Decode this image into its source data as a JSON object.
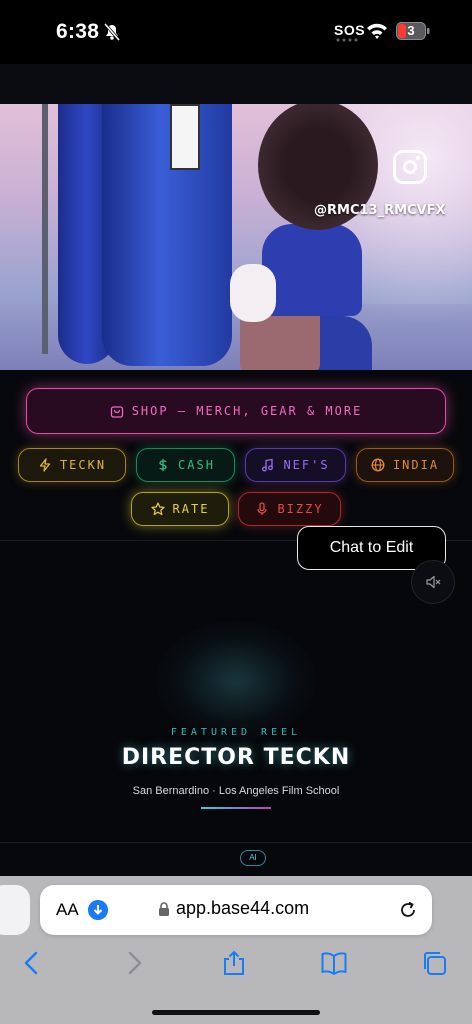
{
  "status_bar": {
    "time": "6:38",
    "sos": "SOS",
    "battery": "3"
  },
  "hero": {
    "instagram_handle": "@RMC13_RMCVFX"
  },
  "links": {
    "shop": "SHOP – MERCH, GEAR & MORE",
    "teckn": "TECKN",
    "cash": "CASH",
    "nefs": "NEF'S",
    "india": "INDIA",
    "rate": "RATE",
    "bizzy": "BIZZY"
  },
  "chat_button": "Chat to Edit",
  "featured": {
    "label": "FEATURED REEL",
    "title": "DIRECTOR TECKN",
    "subtitle": "San Bernardino · Los Angeles Film School"
  },
  "badge": "AI",
  "browser": {
    "aa": "AA",
    "url": "app.base44.com"
  },
  "colors": {
    "shop": "#e24aa6",
    "teckn": "#e0b63a",
    "cash": "#2fc27a",
    "nefs": "#9a6cf0",
    "india": "#e08a3a",
    "rate": "#e8cf3a",
    "bizzy": "#e24a4a",
    "safari_blue": "#1a7cf5"
  }
}
